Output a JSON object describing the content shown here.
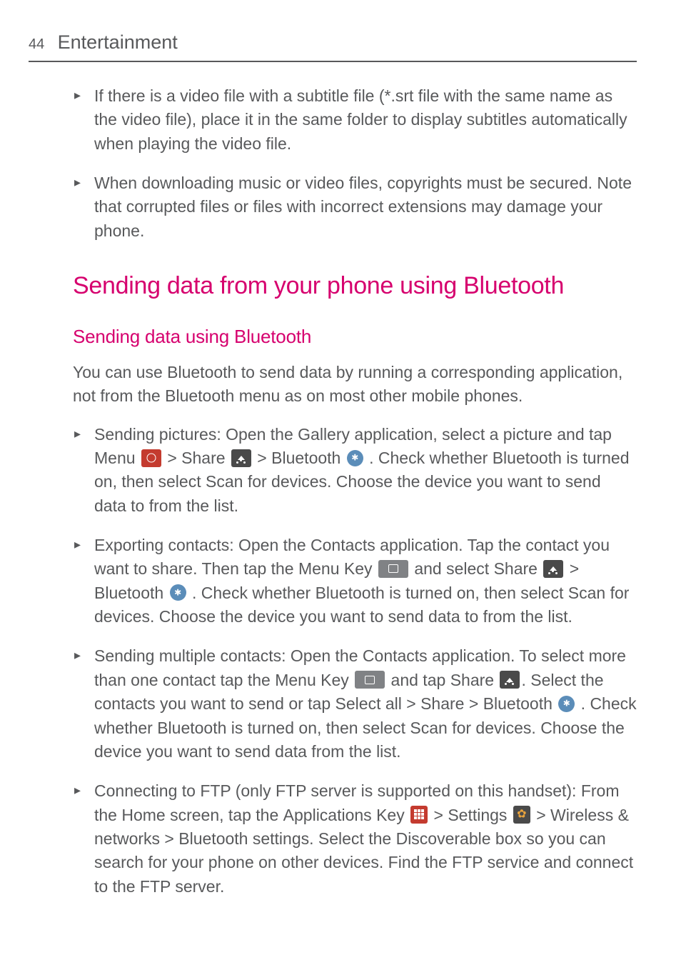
{
  "header": {
    "page_num": "44",
    "title": "Entertainment"
  },
  "intro_bullets": [
    "If there is a video file with a subtitle file (*.srt file with the same name as the video file), place it in the same folder to display subtitles automatically when playing the video file.",
    "When downloading music or video files, copyrights must be secured. Note that corrupted files or files with incorrect extensions may damage your phone."
  ],
  "section": {
    "title": "Sending data from your phone using Bluetooth",
    "subsection": "Sending data using Bluetooth",
    "intro": "You can use Bluetooth to send data by running a corresponding application, not from the Bluetooth menu as on most other mobile phones."
  },
  "items": {
    "sp": {
      "lead": "Sending pictures:",
      "t1": " Open the ",
      "b1": "Gallery",
      "t2": " application, select a picture and tap ",
      "b2": "Menu",
      "t3": " > ",
      "b3": "Share",
      "t4": " > ",
      "b4": "Bluetooth",
      "t5": " . Check whether Bluetooth is turned on, then select ",
      "b5": "Scan for devices",
      "t6": ". Choose the device you want to send data to from the list."
    },
    "ec": {
      "lead": "Exporting contacts:",
      "t1": " Open the ",
      "b1": "Contacts",
      "t2": " application. Tap the contact you want to share. Then tap the ",
      "b2": "Menu Key",
      "t3": " and select ",
      "b3": "Share",
      "t4": " > ",
      "b4": "Bluetooth",
      "t5": " . Check whether Bluetooth is turned on, then select ",
      "b5": "Scan for devices",
      "t6": ". Choose the device you want to send data to from the list."
    },
    "sm": {
      "lead": "Sending multiple contacts:",
      "t1": " Open the ",
      "b1": "Contacts",
      "t2": " application. To select more than one contact tap the ",
      "b2": "Menu Key",
      "t3": " and tap ",
      "b3": "Share",
      "t4": ". Select the contacts you want to send or tap ",
      "b4": "Select all",
      "t5": " > ",
      "b5": "Share",
      "t6": " > ",
      "b6": "Bluetooth",
      "t7": " . Check whether Bluetooth is turned on, then select ",
      "b7": "Scan for devices",
      "t8": ". Choose the device you want to send data from the list."
    },
    "ftp": {
      "lead": "Connecting to FTP (only FTP server is supported on this handset):",
      "t1": " From the Home screen, tap the ",
      "b1": "Applications Key",
      "t2": " > ",
      "b2": "Settings",
      "t3": " > ",
      "b3": "Wireless & networks",
      "t4": " > ",
      "b4": "Bluetooth settings",
      "t5": ". Select the ",
      "b5": "Discoverable",
      "t6": " box so you can search for your phone on other devices. Find the FTP service and connect to the FTP server."
    }
  }
}
